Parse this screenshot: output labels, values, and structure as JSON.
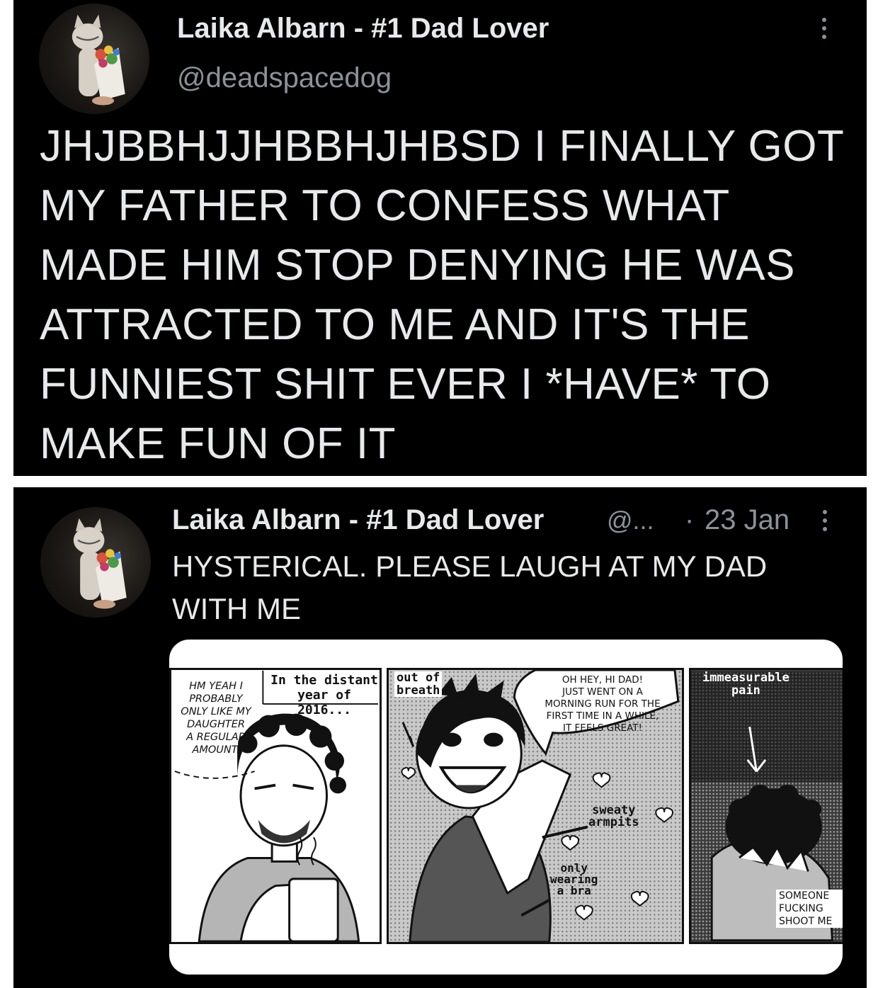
{
  "tweet1": {
    "display_name": "Laika Albarn - #1 Dad Lover",
    "handle": "@deadspacedog",
    "text_lines": [
      "JHJBBHJJHBBHJHBSD I FINALLY GOT",
      "MY FATHER TO CONFESS WHAT",
      "MADE HIM STOP DENYING HE WAS",
      "ATTRACTED TO ME AND IT'S THE",
      "FUNNIEST SHIT EVER I *HAVE* TO",
      "MAKE FUN OF IT"
    ],
    "menu_icon": "more-vertical-icon"
  },
  "tweet2": {
    "display_name": "Laika Albarn - #1 Dad Lover",
    "handle_truncated": "@...",
    "separator": "·",
    "date": "23 Jan",
    "text_lines": [
      "HYSTERICAL. PLEASE LAUGH AT MY DAD",
      "WITH ME"
    ],
    "menu_icon": "more-vertical-icon",
    "comic": {
      "panel1": {
        "speech": [
          "HM YEAH I",
          "PROBABLY",
          "ONLY LIKE MY",
          "DAUGHTER",
          "A REGULAR",
          "AMOUNT."
        ],
        "caption": [
          "In the distant",
          "year of 2016..."
        ]
      },
      "panel2": {
        "label_breath": [
          "out of",
          "breath"
        ],
        "speech": [
          "OH HEY, HI DAD!",
          "JUST WENT ON A",
          "MORNING RUN FOR THE",
          "FIRST TIME IN A WHILE,",
          "IT FEELS GREAT!"
        ],
        "label_sweaty": [
          "sweaty",
          "armpits"
        ],
        "label_bra": [
          "only",
          "wearing",
          "a bra"
        ]
      },
      "panel3": {
        "label_pain": [
          "immeasurable",
          "pain"
        ],
        "speech": [
          "SOMEONE",
          "FUCKING",
          "SHOOT ME"
        ]
      }
    }
  }
}
